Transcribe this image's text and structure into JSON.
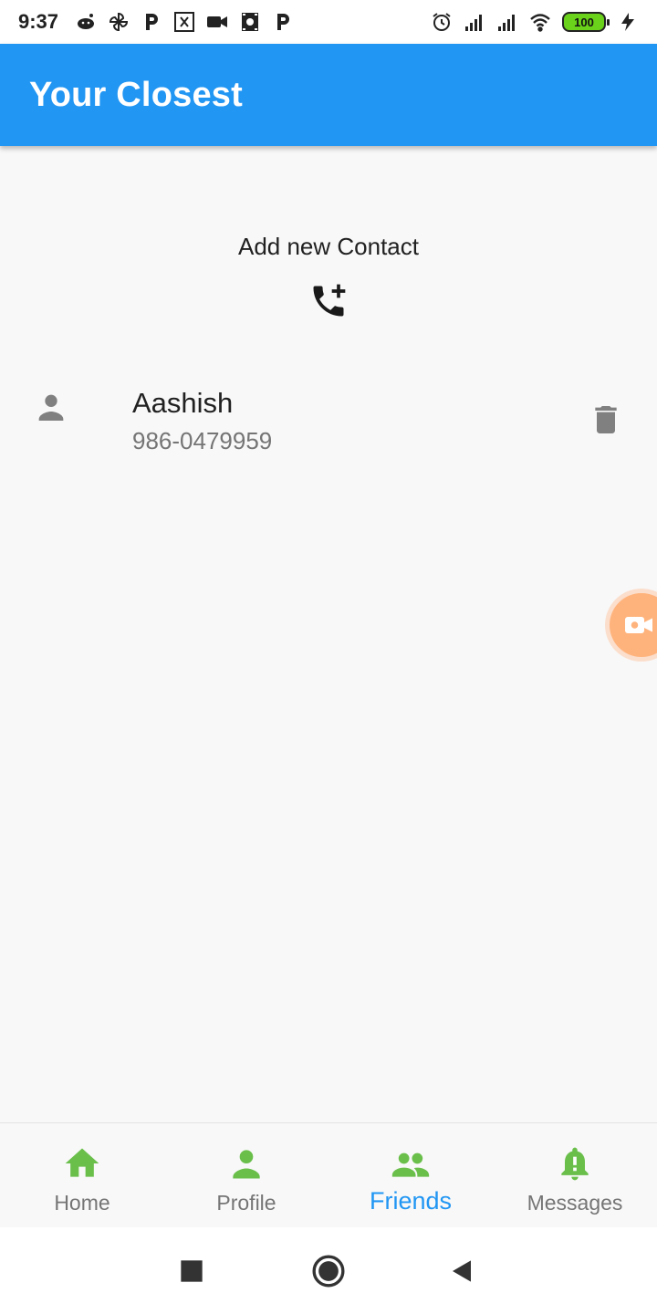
{
  "status_bar": {
    "time": "9:37",
    "battery": "100",
    "notification_icons": [
      "reddit-icon",
      "pinwheel-icon",
      "p-app-icon",
      "x-box-icon",
      "video-camera-icon",
      "film-icon",
      "p-app-icon"
    ],
    "system_icons": [
      "alarm-icon",
      "signal-icon",
      "signal-icon",
      "wifi-icon",
      "battery-icon",
      "charging-icon"
    ]
  },
  "app_bar": {
    "title": "Your Closest",
    "color": "#2196f3"
  },
  "add_contact": {
    "label": "Add new Contact",
    "icon": "add-call-icon"
  },
  "contacts": [
    {
      "name": "Aashish",
      "phone": "986-0479959",
      "icon": "person-icon",
      "action_icon": "delete-icon"
    }
  ],
  "bottom_nav": {
    "icon_color": "#6abf4b",
    "active_color": "#2196f3",
    "items": [
      {
        "label": "Home",
        "icon": "home-icon",
        "active": false
      },
      {
        "label": "Profile",
        "icon": "person-icon",
        "active": false
      },
      {
        "label": "Friends",
        "icon": "people-icon",
        "active": true
      },
      {
        "label": "Messages",
        "icon": "bell-alert-icon",
        "active": false
      }
    ]
  },
  "system_nav": {
    "buttons": [
      "recents-square-icon",
      "home-circle-icon",
      "back-triangle-icon"
    ]
  }
}
